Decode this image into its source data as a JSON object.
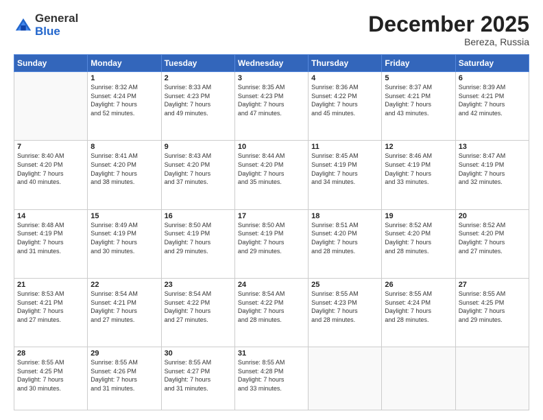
{
  "logo": {
    "general": "General",
    "blue": "Blue"
  },
  "header": {
    "month": "December 2025",
    "location": "Bereza, Russia"
  },
  "weekdays": [
    "Sunday",
    "Monday",
    "Tuesday",
    "Wednesday",
    "Thursday",
    "Friday",
    "Saturday"
  ],
  "weeks": [
    [
      {
        "day": "",
        "info": ""
      },
      {
        "day": "1",
        "info": "Sunrise: 8:32 AM\nSunset: 4:24 PM\nDaylight: 7 hours\nand 52 minutes."
      },
      {
        "day": "2",
        "info": "Sunrise: 8:33 AM\nSunset: 4:23 PM\nDaylight: 7 hours\nand 49 minutes."
      },
      {
        "day": "3",
        "info": "Sunrise: 8:35 AM\nSunset: 4:23 PM\nDaylight: 7 hours\nand 47 minutes."
      },
      {
        "day": "4",
        "info": "Sunrise: 8:36 AM\nSunset: 4:22 PM\nDaylight: 7 hours\nand 45 minutes."
      },
      {
        "day": "5",
        "info": "Sunrise: 8:37 AM\nSunset: 4:21 PM\nDaylight: 7 hours\nand 43 minutes."
      },
      {
        "day": "6",
        "info": "Sunrise: 8:39 AM\nSunset: 4:21 PM\nDaylight: 7 hours\nand 42 minutes."
      }
    ],
    [
      {
        "day": "7",
        "info": "Sunrise: 8:40 AM\nSunset: 4:20 PM\nDaylight: 7 hours\nand 40 minutes."
      },
      {
        "day": "8",
        "info": "Sunrise: 8:41 AM\nSunset: 4:20 PM\nDaylight: 7 hours\nand 38 minutes."
      },
      {
        "day": "9",
        "info": "Sunrise: 8:43 AM\nSunset: 4:20 PM\nDaylight: 7 hours\nand 37 minutes."
      },
      {
        "day": "10",
        "info": "Sunrise: 8:44 AM\nSunset: 4:20 PM\nDaylight: 7 hours\nand 35 minutes."
      },
      {
        "day": "11",
        "info": "Sunrise: 8:45 AM\nSunset: 4:19 PM\nDaylight: 7 hours\nand 34 minutes."
      },
      {
        "day": "12",
        "info": "Sunrise: 8:46 AM\nSunset: 4:19 PM\nDaylight: 7 hours\nand 33 minutes."
      },
      {
        "day": "13",
        "info": "Sunrise: 8:47 AM\nSunset: 4:19 PM\nDaylight: 7 hours\nand 32 minutes."
      }
    ],
    [
      {
        "day": "14",
        "info": "Sunrise: 8:48 AM\nSunset: 4:19 PM\nDaylight: 7 hours\nand 31 minutes."
      },
      {
        "day": "15",
        "info": "Sunrise: 8:49 AM\nSunset: 4:19 PM\nDaylight: 7 hours\nand 30 minutes."
      },
      {
        "day": "16",
        "info": "Sunrise: 8:50 AM\nSunset: 4:19 PM\nDaylight: 7 hours\nand 29 minutes."
      },
      {
        "day": "17",
        "info": "Sunrise: 8:50 AM\nSunset: 4:19 PM\nDaylight: 7 hours\nand 29 minutes."
      },
      {
        "day": "18",
        "info": "Sunrise: 8:51 AM\nSunset: 4:20 PM\nDaylight: 7 hours\nand 28 minutes."
      },
      {
        "day": "19",
        "info": "Sunrise: 8:52 AM\nSunset: 4:20 PM\nDaylight: 7 hours\nand 28 minutes."
      },
      {
        "day": "20",
        "info": "Sunrise: 8:52 AM\nSunset: 4:20 PM\nDaylight: 7 hours\nand 27 minutes."
      }
    ],
    [
      {
        "day": "21",
        "info": "Sunrise: 8:53 AM\nSunset: 4:21 PM\nDaylight: 7 hours\nand 27 minutes."
      },
      {
        "day": "22",
        "info": "Sunrise: 8:54 AM\nSunset: 4:21 PM\nDaylight: 7 hours\nand 27 minutes."
      },
      {
        "day": "23",
        "info": "Sunrise: 8:54 AM\nSunset: 4:22 PM\nDaylight: 7 hours\nand 27 minutes."
      },
      {
        "day": "24",
        "info": "Sunrise: 8:54 AM\nSunset: 4:22 PM\nDaylight: 7 hours\nand 28 minutes."
      },
      {
        "day": "25",
        "info": "Sunrise: 8:55 AM\nSunset: 4:23 PM\nDaylight: 7 hours\nand 28 minutes."
      },
      {
        "day": "26",
        "info": "Sunrise: 8:55 AM\nSunset: 4:24 PM\nDaylight: 7 hours\nand 28 minutes."
      },
      {
        "day": "27",
        "info": "Sunrise: 8:55 AM\nSunset: 4:25 PM\nDaylight: 7 hours\nand 29 minutes."
      }
    ],
    [
      {
        "day": "28",
        "info": "Sunrise: 8:55 AM\nSunset: 4:25 PM\nDaylight: 7 hours\nand 30 minutes."
      },
      {
        "day": "29",
        "info": "Sunrise: 8:55 AM\nSunset: 4:26 PM\nDaylight: 7 hours\nand 31 minutes."
      },
      {
        "day": "30",
        "info": "Sunrise: 8:55 AM\nSunset: 4:27 PM\nDaylight: 7 hours\nand 31 minutes."
      },
      {
        "day": "31",
        "info": "Sunrise: 8:55 AM\nSunset: 4:28 PM\nDaylight: 7 hours\nand 33 minutes."
      },
      {
        "day": "",
        "info": ""
      },
      {
        "day": "",
        "info": ""
      },
      {
        "day": "",
        "info": ""
      }
    ]
  ]
}
